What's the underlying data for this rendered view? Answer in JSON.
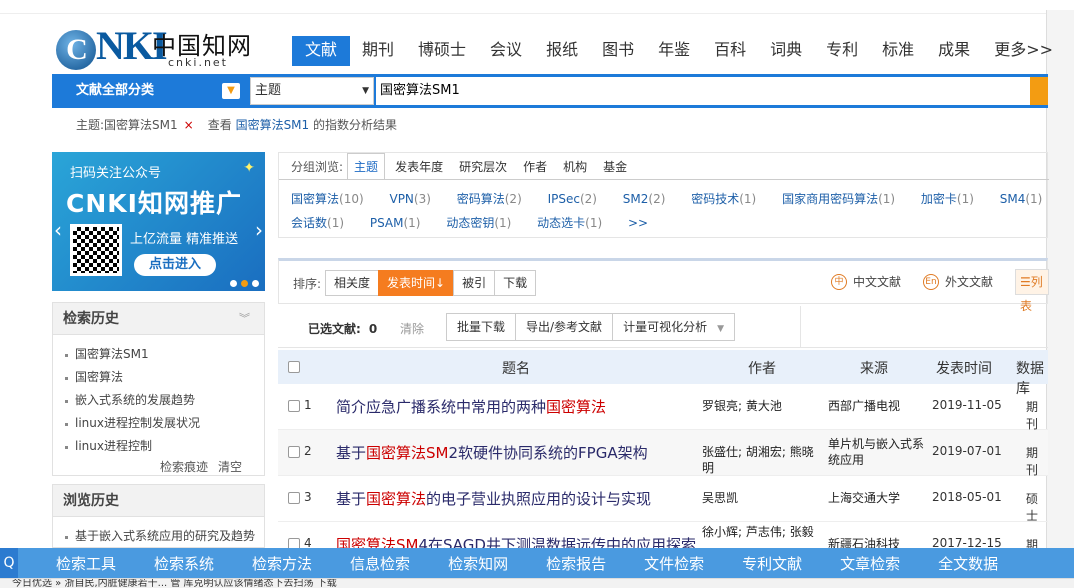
{
  "logo": {
    "brand": "CNKI",
    "cn": "中国知网",
    "url": "cnki.net"
  },
  "nav": [
    "文献",
    "期刊",
    "博硕士",
    "会议",
    "报纸",
    "图书",
    "年鉴",
    "百科",
    "词典",
    "专利",
    "标准",
    "成果",
    "更多>>"
  ],
  "search": {
    "category": "文献全部分类",
    "field": "主题",
    "query": "国密算法SM1"
  },
  "crumbs": {
    "topic": "主题:国密算法SM1",
    "remove": "×",
    "view_prefix": "查看",
    "view_link": "国密算法SM1",
    "view_suffix": "的指数分析结果"
  },
  "promo": {
    "line1": "扫码关注公众号",
    "line2": "CNKI知网推广",
    "line3": "上亿流量 精准推送",
    "button": "点击进入"
  },
  "history": {
    "title": "检索历史",
    "items": [
      "国密算法SM1",
      "国密算法",
      "嵌入式系统的发展趋势",
      "linux进程控制发展状况",
      "linux进程控制"
    ],
    "trace": "检索痕迹",
    "clear": "清空"
  },
  "browse": {
    "title": "浏览历史",
    "items": [
      "基于嵌入式系统应用的研究及趋势"
    ]
  },
  "group": {
    "label": "分组浏览:",
    "tabs": [
      "主题",
      "发表年度",
      "研究层次",
      "作者",
      "机构",
      "基金"
    ],
    "items": [
      {
        "name": "国密算法",
        "count": "(10)"
      },
      {
        "name": "VPN",
        "count": "(3)"
      },
      {
        "name": "密码算法",
        "count": "(2)"
      },
      {
        "name": "IPSec",
        "count": "(2)"
      },
      {
        "name": "SM2",
        "count": "(2)"
      },
      {
        "name": "密码技术",
        "count": "(1)"
      },
      {
        "name": "国家商用密码算法",
        "count": "(1)"
      },
      {
        "name": "加密卡",
        "count": "(1)"
      },
      {
        "name": "SM4",
        "count": "(1)"
      },
      {
        "name": "会话数",
        "count": "(1)"
      },
      {
        "name": "PSAM",
        "count": "(1)"
      },
      {
        "name": "动态密钥",
        "count": "(1)"
      },
      {
        "name": "动态选卡",
        "count": "(1)"
      }
    ],
    "more": ">>"
  },
  "sort": {
    "label": "排序:",
    "options": [
      "相关度",
      "发表时间↓",
      "被引",
      "下载"
    ],
    "chinese": "中文文献",
    "foreign": "外文文献",
    "list": "☰列表"
  },
  "selection": {
    "label": "已选文献:",
    "count": "0",
    "clear": "清除",
    "batch": "批量下载",
    "export": "导出/参考文献",
    "viz": "计量可视化分析"
  },
  "table": {
    "headers": {
      "title": "题名",
      "author": "作者",
      "source": "来源",
      "date": "发表时间",
      "db": "数据库"
    },
    "rows": [
      {
        "no": "1",
        "pre": "简介应急广播系统中常用的两种",
        "hl": "国密算法",
        "post": "",
        "author": "罗银亮; 黄大池",
        "source": "西部广播电视",
        "date": "2019-11-05",
        "db": "期刊"
      },
      {
        "no": "2",
        "pre": "基于",
        "hl": "国密算法SM",
        "post": "2软硬件协同系统的FPGA架构",
        "author": "张盛仕; 胡湘宏; 熊晓明",
        "source": "单片机与嵌入式系统应用",
        "date": "2019-07-01",
        "db": "期刊"
      },
      {
        "no": "3",
        "pre": "基于",
        "hl": "国密算法",
        "post": "的电子营业执照应用的设计与实现",
        "author": "吴思凯",
        "source": "上海交通大学",
        "date": "2018-05-01",
        "db": "硕士"
      },
      {
        "no": "4",
        "pre": "",
        "hl": "国密算法SM",
        "post": "4在SAGD井下测温数据远传中的应用探索",
        "author": "徐小辉; 芦志伟; 张毅",
        "source": "新疆石油科技",
        "date": "2017-12-15",
        "db": "期刊"
      }
    ]
  },
  "bottomnav": [
    "检索工具",
    "检索系统",
    "检索方法",
    "信息检索",
    "检索知网",
    "检索报告",
    "文件检索",
    "专利文献",
    "文章检索",
    "全文数据"
  ],
  "status": "今日优选   » 浙自民,内脏健康若干...   管   库克明认应该情绪态下去扫荡   下载"
}
